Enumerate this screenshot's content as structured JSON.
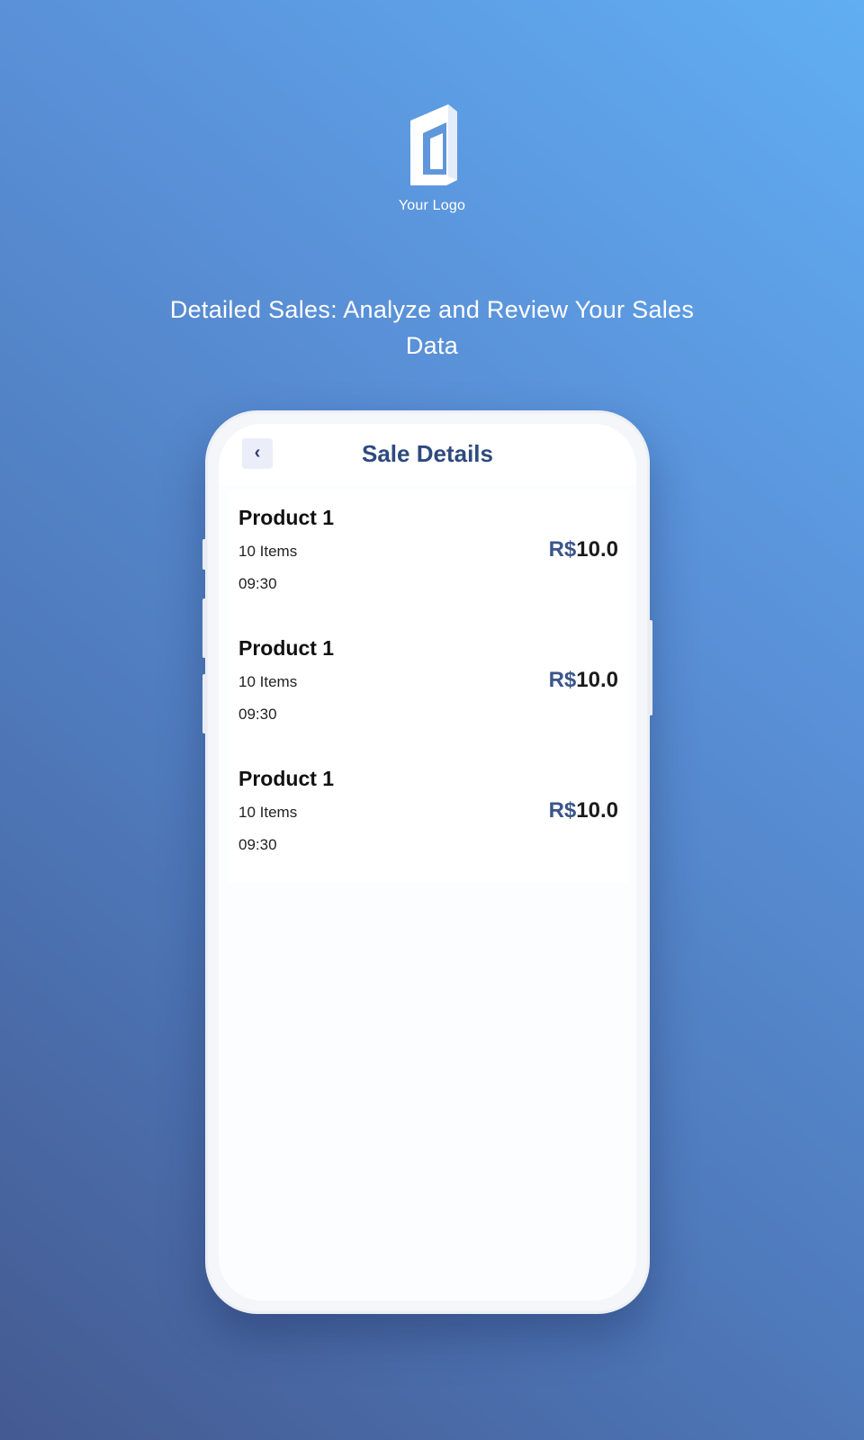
{
  "branding": {
    "logo_text": "Your Logo",
    "headline": "Detailed Sales: Analyze and Review Your Sales Data"
  },
  "colors": {
    "background_top": "#61aef3",
    "background_bottom": "#445a91",
    "title_blue": "#2e4a80",
    "currency_blue": "#3b5689",
    "back_button_bg": "#ebedf9"
  },
  "app": {
    "back_icon": "chevron-left-icon",
    "back_glyph": "‹",
    "title": "Sale Details",
    "sales": [
      {
        "product": "Product 1",
        "items": "10 Items",
        "time": "09:30",
        "currency": "R$",
        "amount": "10.0"
      },
      {
        "product": "Product 1",
        "items": "10 Items",
        "time": "09:30",
        "currency": "R$",
        "amount": "10.0"
      },
      {
        "product": "Product 1",
        "items": "10 Items",
        "time": "09:30",
        "currency": "R$",
        "amount": "10.0"
      }
    ]
  }
}
